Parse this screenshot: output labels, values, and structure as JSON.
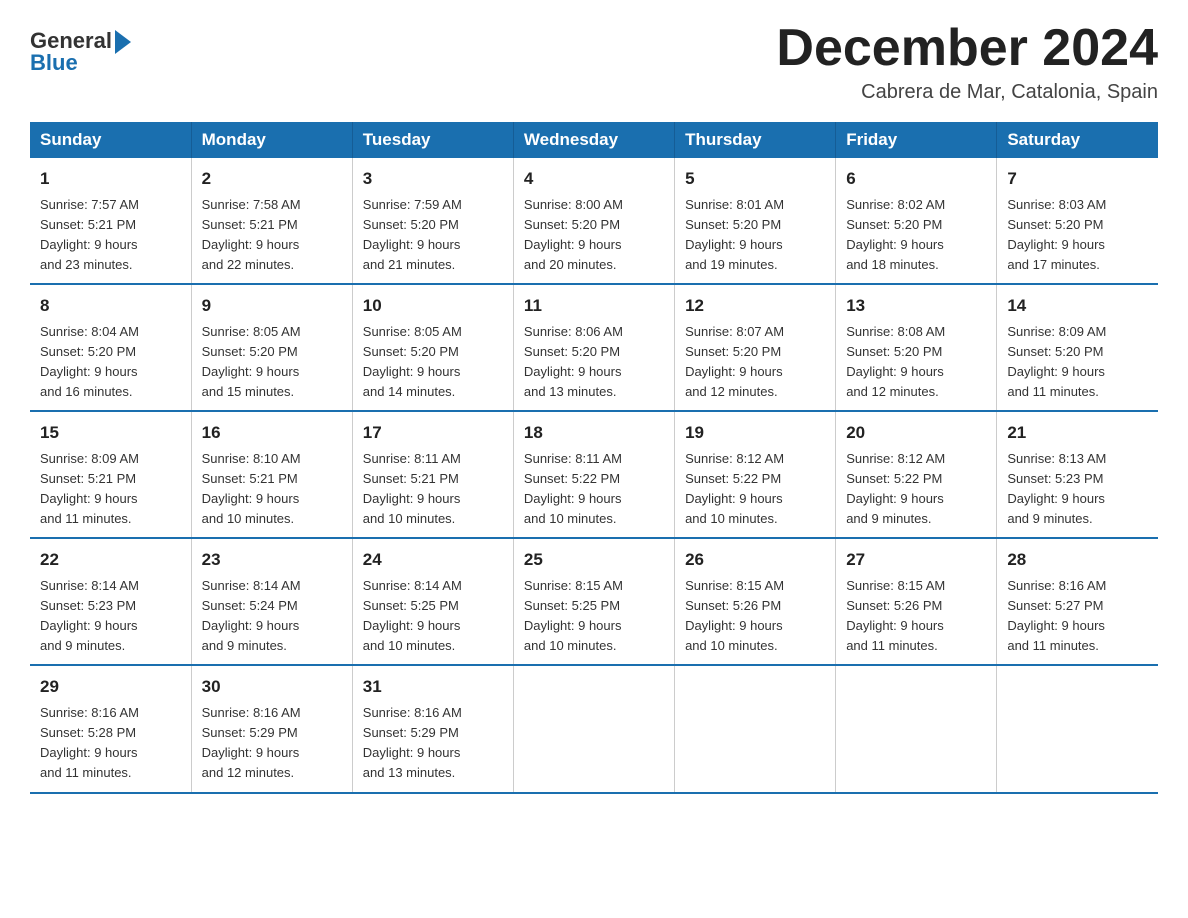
{
  "logo": {
    "general": "General",
    "blue": "Blue"
  },
  "title": "December 2024",
  "location": "Cabrera de Mar, Catalonia, Spain",
  "headers": [
    "Sunday",
    "Monday",
    "Tuesday",
    "Wednesday",
    "Thursday",
    "Friday",
    "Saturday"
  ],
  "weeks": [
    [
      {
        "day": "1",
        "sunrise": "7:57 AM",
        "sunset": "5:21 PM",
        "daylight": "9 hours and 23 minutes."
      },
      {
        "day": "2",
        "sunrise": "7:58 AM",
        "sunset": "5:21 PM",
        "daylight": "9 hours and 22 minutes."
      },
      {
        "day": "3",
        "sunrise": "7:59 AM",
        "sunset": "5:20 PM",
        "daylight": "9 hours and 21 minutes."
      },
      {
        "day": "4",
        "sunrise": "8:00 AM",
        "sunset": "5:20 PM",
        "daylight": "9 hours and 20 minutes."
      },
      {
        "day": "5",
        "sunrise": "8:01 AM",
        "sunset": "5:20 PM",
        "daylight": "9 hours and 19 minutes."
      },
      {
        "day": "6",
        "sunrise": "8:02 AM",
        "sunset": "5:20 PM",
        "daylight": "9 hours and 18 minutes."
      },
      {
        "day": "7",
        "sunrise": "8:03 AM",
        "sunset": "5:20 PM",
        "daylight": "9 hours and 17 minutes."
      }
    ],
    [
      {
        "day": "8",
        "sunrise": "8:04 AM",
        "sunset": "5:20 PM",
        "daylight": "9 hours and 16 minutes."
      },
      {
        "day": "9",
        "sunrise": "8:05 AM",
        "sunset": "5:20 PM",
        "daylight": "9 hours and 15 minutes."
      },
      {
        "day": "10",
        "sunrise": "8:05 AM",
        "sunset": "5:20 PM",
        "daylight": "9 hours and 14 minutes."
      },
      {
        "day": "11",
        "sunrise": "8:06 AM",
        "sunset": "5:20 PM",
        "daylight": "9 hours and 13 minutes."
      },
      {
        "day": "12",
        "sunrise": "8:07 AM",
        "sunset": "5:20 PM",
        "daylight": "9 hours and 12 minutes."
      },
      {
        "day": "13",
        "sunrise": "8:08 AM",
        "sunset": "5:20 PM",
        "daylight": "9 hours and 12 minutes."
      },
      {
        "day": "14",
        "sunrise": "8:09 AM",
        "sunset": "5:20 PM",
        "daylight": "9 hours and 11 minutes."
      }
    ],
    [
      {
        "day": "15",
        "sunrise": "8:09 AM",
        "sunset": "5:21 PM",
        "daylight": "9 hours and 11 minutes."
      },
      {
        "day": "16",
        "sunrise": "8:10 AM",
        "sunset": "5:21 PM",
        "daylight": "9 hours and 10 minutes."
      },
      {
        "day": "17",
        "sunrise": "8:11 AM",
        "sunset": "5:21 PM",
        "daylight": "9 hours and 10 minutes."
      },
      {
        "day": "18",
        "sunrise": "8:11 AM",
        "sunset": "5:22 PM",
        "daylight": "9 hours and 10 minutes."
      },
      {
        "day": "19",
        "sunrise": "8:12 AM",
        "sunset": "5:22 PM",
        "daylight": "9 hours and 10 minutes."
      },
      {
        "day": "20",
        "sunrise": "8:12 AM",
        "sunset": "5:22 PM",
        "daylight": "9 hours and 9 minutes."
      },
      {
        "day": "21",
        "sunrise": "8:13 AM",
        "sunset": "5:23 PM",
        "daylight": "9 hours and 9 minutes."
      }
    ],
    [
      {
        "day": "22",
        "sunrise": "8:14 AM",
        "sunset": "5:23 PM",
        "daylight": "9 hours and 9 minutes."
      },
      {
        "day": "23",
        "sunrise": "8:14 AM",
        "sunset": "5:24 PM",
        "daylight": "9 hours and 9 minutes."
      },
      {
        "day": "24",
        "sunrise": "8:14 AM",
        "sunset": "5:25 PM",
        "daylight": "9 hours and 10 minutes."
      },
      {
        "day": "25",
        "sunrise": "8:15 AM",
        "sunset": "5:25 PM",
        "daylight": "9 hours and 10 minutes."
      },
      {
        "day": "26",
        "sunrise": "8:15 AM",
        "sunset": "5:26 PM",
        "daylight": "9 hours and 10 minutes."
      },
      {
        "day": "27",
        "sunrise": "8:15 AM",
        "sunset": "5:26 PM",
        "daylight": "9 hours and 11 minutes."
      },
      {
        "day": "28",
        "sunrise": "8:16 AM",
        "sunset": "5:27 PM",
        "daylight": "9 hours and 11 minutes."
      }
    ],
    [
      {
        "day": "29",
        "sunrise": "8:16 AM",
        "sunset": "5:28 PM",
        "daylight": "9 hours and 11 minutes."
      },
      {
        "day": "30",
        "sunrise": "8:16 AM",
        "sunset": "5:29 PM",
        "daylight": "9 hours and 12 minutes."
      },
      {
        "day": "31",
        "sunrise": "8:16 AM",
        "sunset": "5:29 PM",
        "daylight": "9 hours and 13 minutes."
      },
      null,
      null,
      null,
      null
    ]
  ],
  "labels": {
    "sunrise": "Sunrise:",
    "sunset": "Sunset:",
    "daylight": "Daylight:"
  }
}
